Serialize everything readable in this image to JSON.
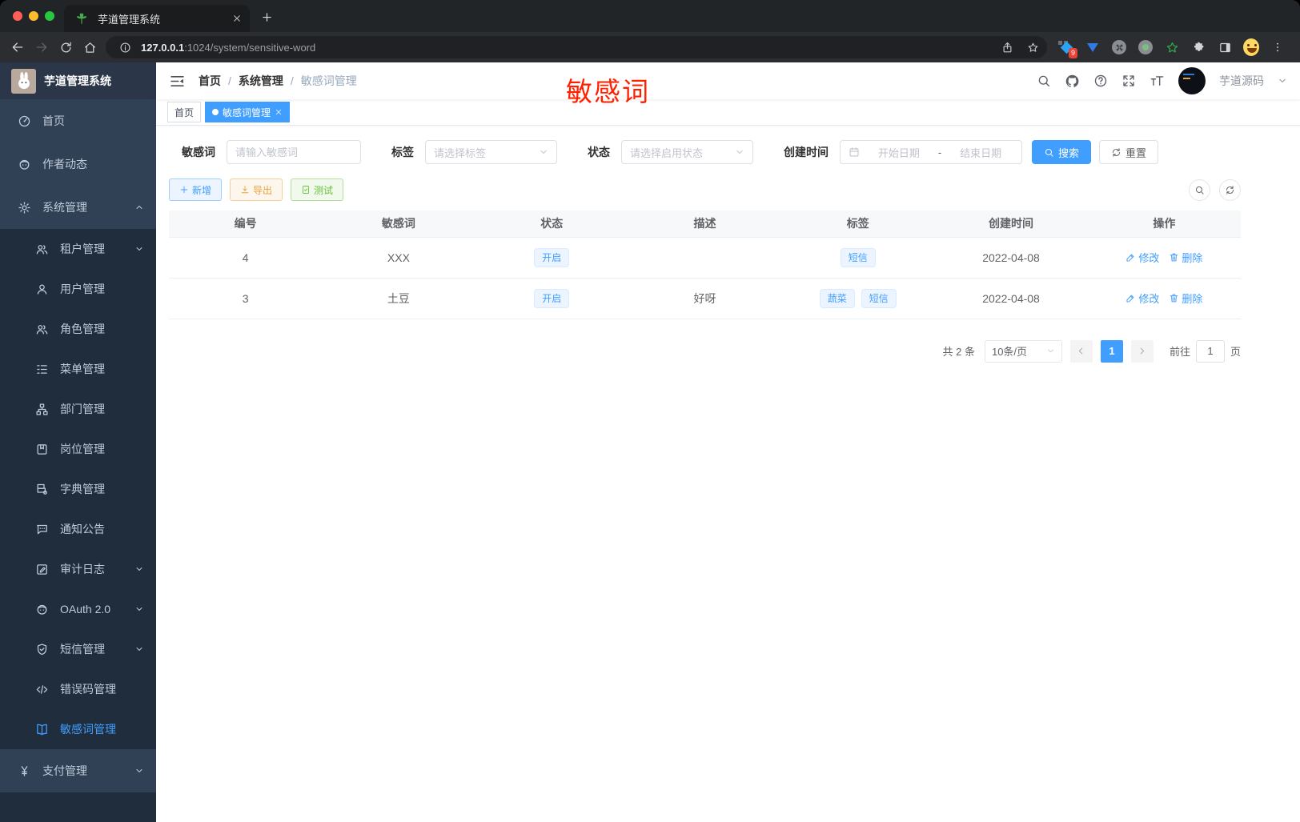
{
  "browser": {
    "tab": {
      "title": "芋道管理系统"
    },
    "url": {
      "host": "127.0.0.1",
      "rest": ":1024/system/sensitive-word"
    },
    "extension_badge": "9",
    "extension_icons": [
      "share-icon",
      "star-icon",
      "diamond-extension-icon",
      "funnel-extension-icon",
      "command-extension-icon",
      "record-extension-icon",
      "green-star-extension-icon",
      "puzzle-icon",
      "side-panel-icon",
      "profile-emoji-icon",
      "kebab-menu-icon"
    ]
  },
  "sidebar": {
    "title": "芋道管理系统",
    "items": [
      {
        "label": "首页",
        "icon": "dashboard-icon",
        "level": 1
      },
      {
        "label": "作者动态",
        "icon": "chat-icon",
        "level": 1
      },
      {
        "label": "系统管理",
        "icon": "gear-icon",
        "level": 1,
        "arrow": "up"
      },
      {
        "label": "租户管理",
        "icon": "users-icon",
        "level": 2,
        "arrow": "down"
      },
      {
        "label": "用户管理",
        "icon": "user-icon",
        "level": 2
      },
      {
        "label": "角色管理",
        "icon": "users-icon",
        "level": 2
      },
      {
        "label": "菜单管理",
        "icon": "tree-icon",
        "level": 2
      },
      {
        "label": "部门管理",
        "icon": "org-icon",
        "level": 2
      },
      {
        "label": "岗位管理",
        "icon": "badge-icon",
        "level": 2
      },
      {
        "label": "字典管理",
        "icon": "books-icon",
        "level": 2
      },
      {
        "label": "通知公告",
        "icon": "comment-icon",
        "level": 2
      },
      {
        "label": "审计日志",
        "icon": "edit-note-icon",
        "level": 2,
        "arrow": "down"
      },
      {
        "label": "OAuth 2.0",
        "icon": "face-icon",
        "level": 2,
        "arrow": "down"
      },
      {
        "label": "短信管理",
        "icon": "shield-icon",
        "level": 2,
        "arrow": "down"
      },
      {
        "label": "错误码管理",
        "icon": "code-icon",
        "level": 2
      },
      {
        "label": "敏感词管理",
        "icon": "open-book-icon",
        "level": 2,
        "active": true
      },
      {
        "label": "支付管理",
        "icon": "yen-icon",
        "level": 1,
        "arrow": "down"
      }
    ]
  },
  "header": {
    "breadcrumb": [
      "首页",
      "系统管理",
      "敏感词管理"
    ],
    "separator": "/",
    "annotation": "敏感词",
    "icons": [
      "search-icon",
      "github-icon",
      "question-icon",
      "fullscreen-icon",
      "fontsize-icon"
    ],
    "user": {
      "name": "芋道源码"
    }
  },
  "tagbar": {
    "tags": [
      {
        "label": "首页",
        "active": false
      },
      {
        "label": "敏感词管理",
        "active": true
      }
    ]
  },
  "filters": {
    "keyword": {
      "label": "敏感词",
      "placeholder": "请输入敏感词",
      "value": ""
    },
    "tag": {
      "label": "标签",
      "placeholder": "请选择标签"
    },
    "status": {
      "label": "状态",
      "placeholder": "请选择启用状态"
    },
    "date": {
      "label": "创建时间",
      "start_placeholder": "开始日期",
      "separator": "-",
      "end_placeholder": "结束日期"
    },
    "search_label": "搜索",
    "reset_label": "重置"
  },
  "toolbar": {
    "add_label": "新增",
    "export_label": "导出",
    "test_label": "测试"
  },
  "table": {
    "columns": [
      "编号",
      "敏感词",
      "状态",
      "描述",
      "标签",
      "创建时间",
      "操作"
    ],
    "rows": [
      {
        "id": "4",
        "word": "XXX",
        "status": "开启",
        "description": "",
        "tags": [
          "短信"
        ],
        "created": "2022-04-08"
      },
      {
        "id": "3",
        "word": "土豆",
        "status": "开启",
        "description": "好呀",
        "tags": [
          "蔬菜",
          "短信"
        ],
        "created": "2022-04-08"
      }
    ],
    "edit_label": "修改",
    "delete_label": "删除"
  },
  "pagination": {
    "total": "共 2 条",
    "page_size": "10条/页",
    "current_page": "1",
    "goto_label": "前往",
    "goto_value": "1",
    "unit_label": "页"
  },
  "colors": {
    "accent": "#409eff",
    "sidebar_bg": "#304156",
    "submenu_bg": "#1f2d3d",
    "annotation": "#ff2000",
    "warning": "#e6a23c",
    "success": "#67c23a",
    "tag_bg": "#ecf5ff"
  }
}
